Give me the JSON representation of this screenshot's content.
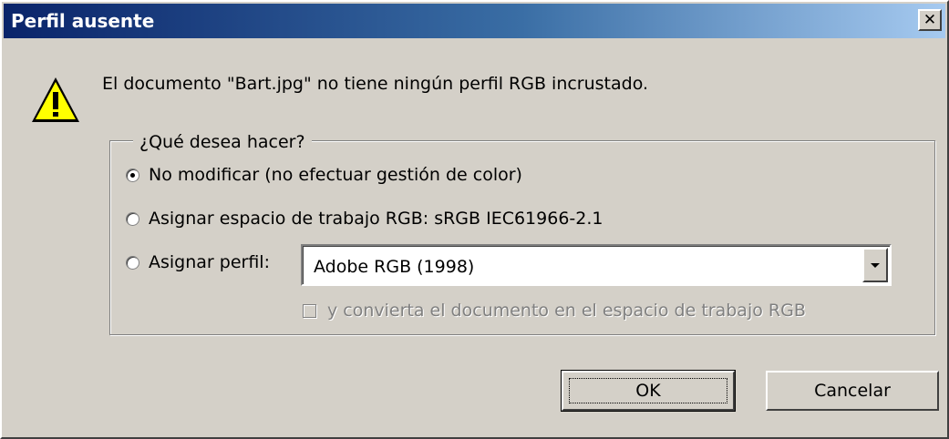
{
  "window": {
    "title": "Perfil ausente",
    "close_glyph": "✕"
  },
  "message": "El documento \"Bart.jpg\" no tiene ningún perfil RGB incrustado.",
  "icon": "warning-icon",
  "group": {
    "legend": "¿Qué desea hacer?",
    "options": [
      {
        "label": "No modificar (no efectuar gestión de color)",
        "selected": true
      },
      {
        "label": "Asignar espacio de trabajo RGB: sRGB IEC61966-2.1",
        "selected": false
      },
      {
        "label": "Asignar perfil:",
        "selected": false
      }
    ],
    "profile_select": {
      "value": "Adobe RGB (1998)"
    },
    "convert_checkbox": {
      "label": "y convierta el documento en el espacio de trabajo RGB",
      "checked": false,
      "enabled": false
    }
  },
  "buttons": {
    "ok": "OK",
    "cancel": "Cancelar"
  },
  "colors": {
    "title_bar_start": "#0a246a",
    "title_bar_end": "#a6caf0",
    "dialog_face": "#d4d0c8",
    "disabled_text": "#808080"
  }
}
